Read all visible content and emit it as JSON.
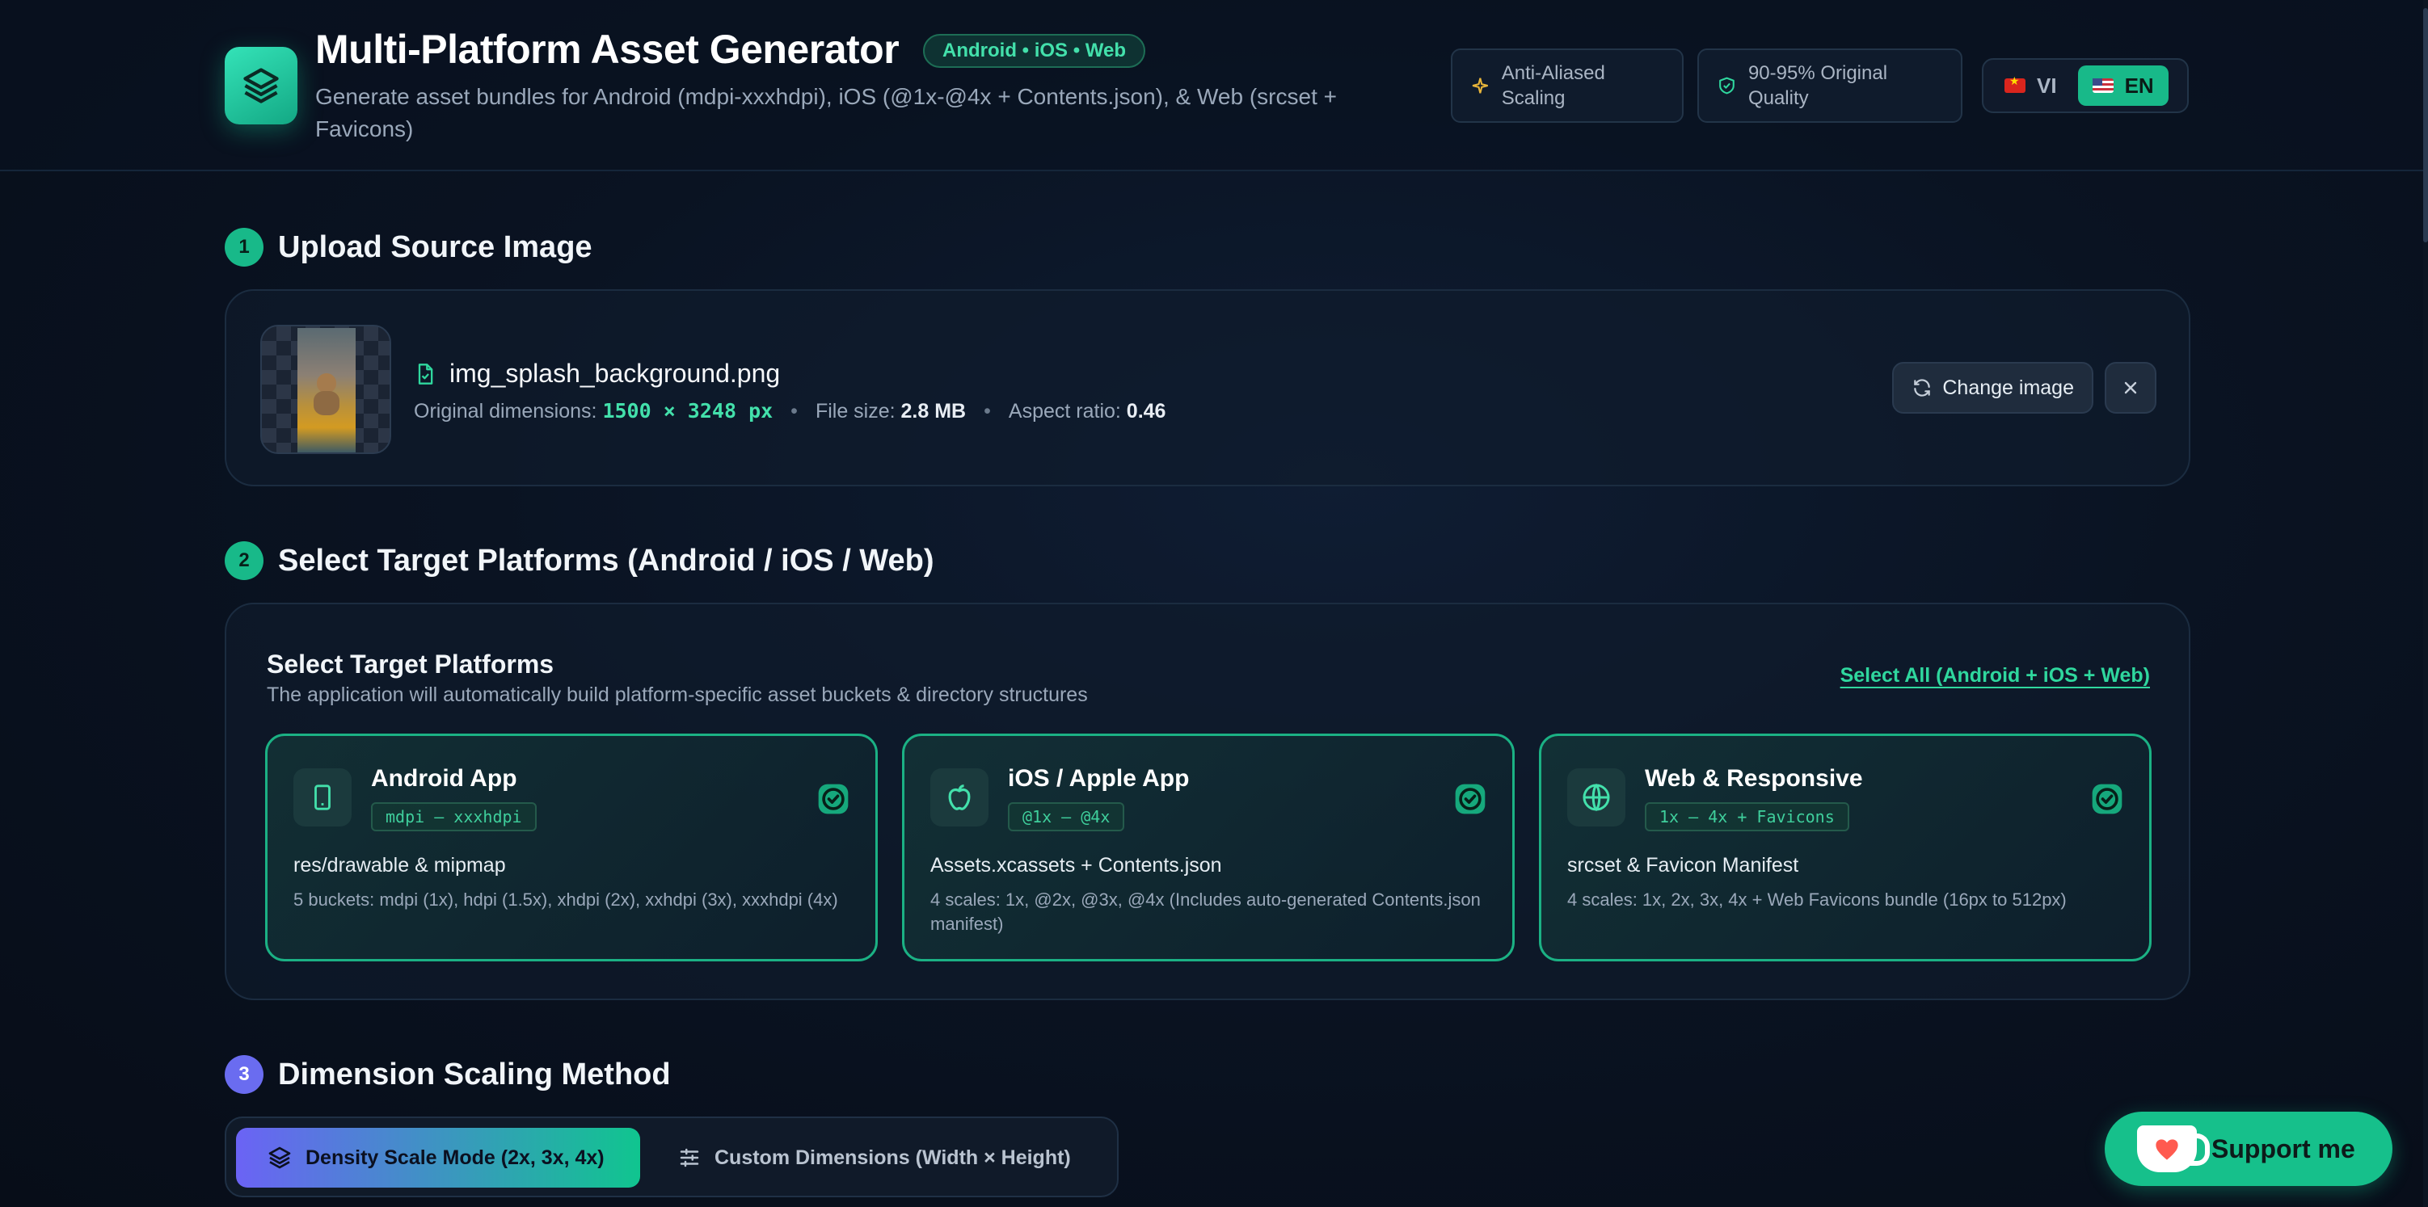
{
  "header": {
    "title": "Multi-Platform Asset Generator",
    "platform_badge": "Android • iOS • Web",
    "subtitle": "Generate asset bundles for Android (mdpi-xxxhdpi), iOS (@1x-@4x + Contents.json), & Web (srcset + Favicons)",
    "feature_pills": [
      {
        "label": "Anti-Aliased Scaling",
        "icon": "sparkle-icon",
        "color": "#e8b53a"
      },
      {
        "label": "90-95% Original Quality",
        "icon": "shield-check-icon",
        "color": "#2fd79e"
      }
    ],
    "languages": [
      {
        "code": "VI",
        "flag": "vn-flag-icon",
        "active": false
      },
      {
        "code": "EN",
        "flag": "us-flag-icon",
        "active": true
      }
    ]
  },
  "steps": {
    "upload": {
      "number": "1",
      "title": "Upload Source Image"
    },
    "platforms": {
      "number": "2",
      "title": "Select Target Platforms (Android / iOS / Web)"
    },
    "scaling": {
      "number": "3",
      "title": "Dimension Scaling Method"
    }
  },
  "upload": {
    "file_name": "img_splash_background.png",
    "dimensions_label": "Original dimensions:",
    "dimensions_value": "1500 × 3248 px",
    "file_size_label": "File size:",
    "file_size_value": "2.8 MB",
    "aspect_label": "Aspect ratio:",
    "aspect_value": "0.46",
    "change_button": "Change image"
  },
  "platforms": {
    "title": "Select Target Platforms",
    "subtitle": "The application will automatically build platform-specific asset buckets & directory structures",
    "select_all": "Select All (Android + iOS + Web)",
    "items": [
      {
        "name": "Android App",
        "tag": "mdpi – xxxhdpi",
        "icon": "smartphone-icon",
        "heading": "res/drawable & mipmap",
        "description": "5 buckets: mdpi (1x), hdpi (1.5x), xhdpi (2x), xxhdpi (3x), xxxhdpi (4x)",
        "checked": true
      },
      {
        "name": "iOS / Apple App",
        "tag": "@1x – @4x",
        "icon": "apple-icon",
        "heading": "Assets.xcassets + Contents.json",
        "description": "4 scales: 1x, @2x, @3x, @4x (Includes auto-generated Contents.json manifest)",
        "checked": true
      },
      {
        "name": "Web & Responsive",
        "tag": "1x – 4x + Favicons",
        "icon": "globe-icon",
        "heading": "srcset & Favicon Manifest",
        "description": "4 scales: 1x, 2x, 3x, 4x + Web Favicons bundle (16px to 512px)",
        "checked": true
      }
    ]
  },
  "scaling": {
    "modes": [
      {
        "label": "Density Scale Mode (2x, 3x, 4x)",
        "icon": "layers-icon",
        "active": true
      },
      {
        "label": "Custom Dimensions (Width × Height)",
        "icon": "sliders-icon",
        "active": false
      }
    ]
  },
  "support": {
    "label": "Support me",
    "icon": "ko-fi-cup-icon"
  },
  "colors": {
    "accent": "#18b989",
    "accent_text": "#43e0ab",
    "step3": "#6a6cf0",
    "background": "#0a1322"
  }
}
